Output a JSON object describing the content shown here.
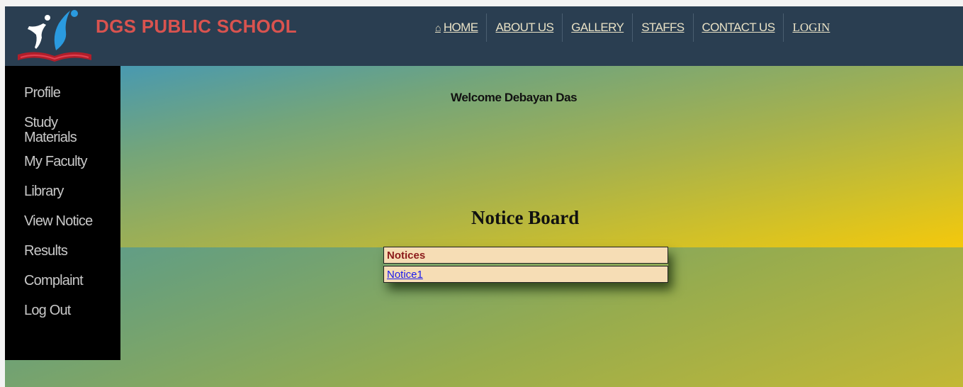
{
  "header": {
    "brand": "DGS PUBLIC SCHOOL",
    "nav": [
      {
        "label": "HOME",
        "icon": "home-icon"
      },
      {
        "label": "ABOUT US"
      },
      {
        "label": "GALLERY"
      },
      {
        "label": "STAFFS"
      },
      {
        "label": "CONTACT US"
      },
      {
        "label": "LOGIN"
      }
    ]
  },
  "sidebar": {
    "items": [
      {
        "label": "Profile"
      },
      {
        "label": "Study Materials"
      },
      {
        "label": "My Faculty"
      },
      {
        "label": "Library"
      },
      {
        "label": "View Notice"
      },
      {
        "label": "Results"
      },
      {
        "label": "Complaint"
      },
      {
        "label": "Log Out"
      }
    ]
  },
  "main": {
    "welcome": "Welcome Debayan Das",
    "notice_board_title": "Notice Board",
    "notices_header": "Notices",
    "notices": [
      "Notice1"
    ]
  },
  "colors": {
    "header_bg": "#2a3e51",
    "brand": "#d9534f",
    "nav_text": "#e9e2c6",
    "sidebar_bg": "#000000",
    "sidebar_text": "#c9c9c9",
    "notice_row_bg": "#f6ddb5",
    "notice_header_text": "#8b1a1a",
    "link": "#1a1aee"
  }
}
